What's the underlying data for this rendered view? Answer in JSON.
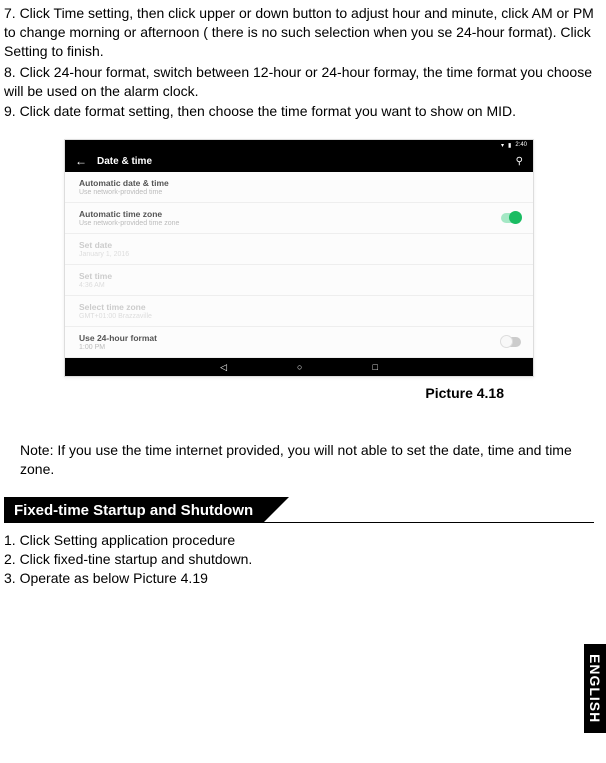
{
  "instructions": {
    "item7": "7. Click Time setting, then click upper or down button to adjust hour and minute, click AM or PM to change morning or afternoon ( there is no such selection when you se 24-hour format). Click Setting to finish.",
    "item8": "8. Click 24-hour format, switch between 12-hour or 24-hour formay, the time format you choose will be used on the alarm clock.",
    "item9": "9. Click date format setting, then choose the time format you want to show on MID."
  },
  "tablet": {
    "status_time": "2:40",
    "header": {
      "title": "Date & time"
    },
    "rows": {
      "auto_date": {
        "label": "Automatic date & time",
        "sub": "Use network-provided time"
      },
      "auto_zone": {
        "label": "Automatic time zone",
        "sub": "Use network-provided time zone"
      },
      "set_date": {
        "label": "Set date",
        "sub": "January 1, 2016"
      },
      "set_time": {
        "label": "Set time",
        "sub": "4:36 AM"
      },
      "select_zone": {
        "label": "Select time zone",
        "sub": "GMT+01:00 Brazzaville"
      },
      "use_24h": {
        "label": "Use 24-hour format",
        "sub": "1:00 PM"
      }
    }
  },
  "picture_label": "Picture 4.18",
  "note": "Note: If you use the time internet provided, you will not able to set the date, time and time zone.",
  "section_title": "Fixed-time Startup and Shutdown",
  "steps": {
    "s1": "1. Click Setting application procedure",
    "s2": "2. Click fixed-tine startup and shutdown.",
    "s3": "3. Operate as below Picture 4.19"
  },
  "side_tab": "ENGLISH"
}
